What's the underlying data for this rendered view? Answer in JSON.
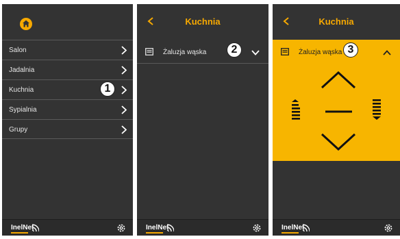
{
  "colors": {
    "accent": "#f7a900",
    "panel": "#333333",
    "control_bg": "#f7b500"
  },
  "screen1": {
    "header_icon": "home-icon",
    "menu": [
      {
        "label": "Salon"
      },
      {
        "label": "Jadalnia"
      },
      {
        "label": "Kuchnia"
      },
      {
        "label": "Sypialnia"
      },
      {
        "label": "Grupy"
      }
    ],
    "callout": "1"
  },
  "screen2": {
    "title": "Kuchnia",
    "device": {
      "label": "Żaluzja wąska",
      "state": "collapsed"
    },
    "callout": "2"
  },
  "screen3": {
    "title": "Kuchnia",
    "device": {
      "label": "Żaluzja wąska",
      "state": "expanded"
    },
    "callout": "3",
    "controls": [
      "tilt-open-icon",
      "up-icon",
      "stop-icon",
      "down-icon",
      "tilt-close-icon"
    ]
  },
  "footer": {
    "logo": "InelNet",
    "icons": [
      "wifi-icon",
      "settings-gear-icon"
    ]
  }
}
